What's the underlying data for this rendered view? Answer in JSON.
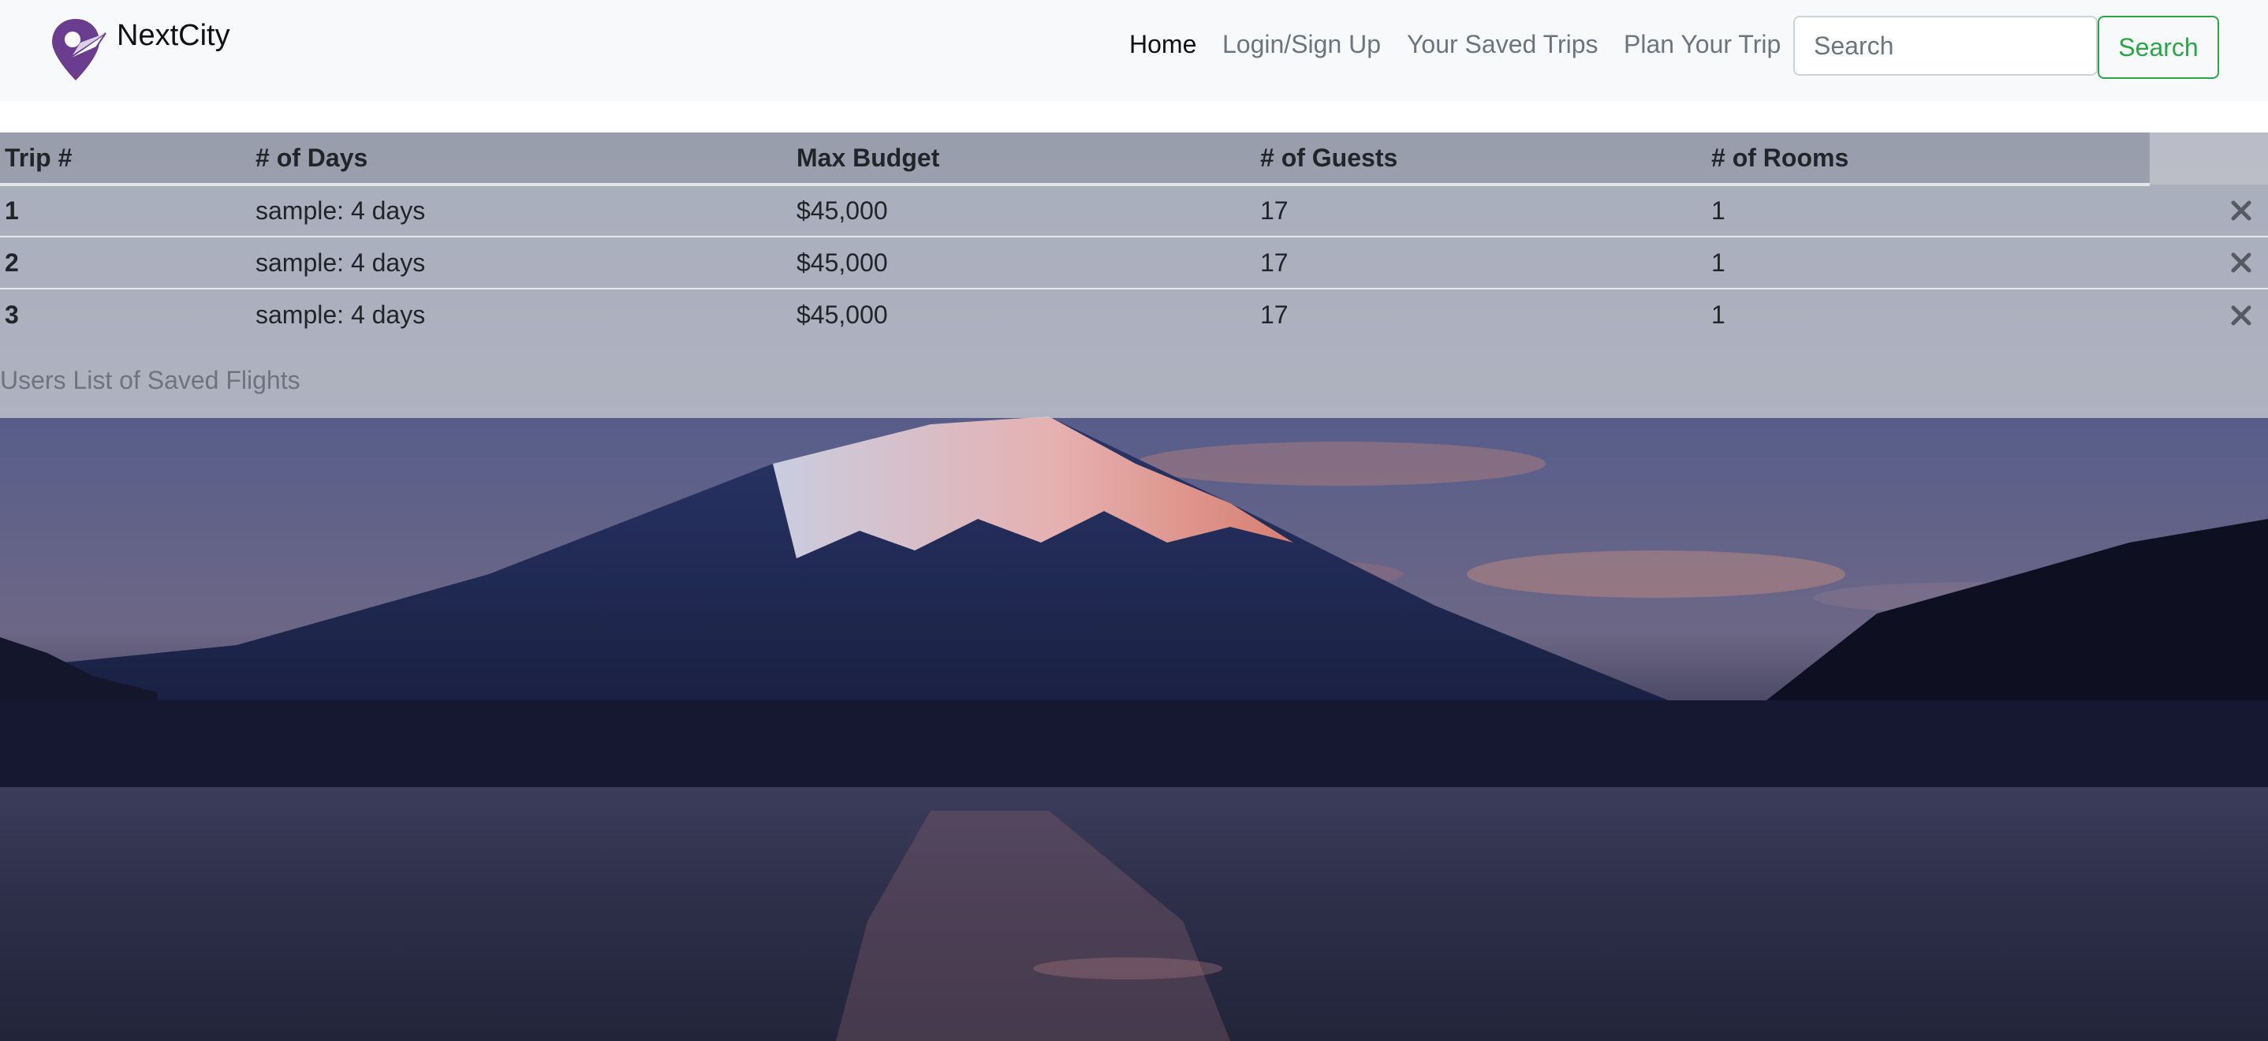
{
  "brand": {
    "name": "NextCity",
    "logo": "location-pin-plane-icon",
    "logo_color": "#6a3d8f"
  },
  "nav": {
    "links": [
      {
        "label": "Home",
        "active": true
      },
      {
        "label": "Login/Sign Up",
        "active": false
      },
      {
        "label": "Your Saved Trips",
        "active": false
      },
      {
        "label": "Plan Your Trip",
        "active": false
      }
    ],
    "search_placeholder": "Search",
    "search_button": "Search",
    "accent_color": "#28a745"
  },
  "table": {
    "headers": [
      "Trip #",
      "# of Days",
      "Max Budget",
      "# of Guests",
      "# of Rooms"
    ],
    "rows": [
      {
        "trip": "1",
        "days": "sample: 4 days",
        "budget": "$45,000",
        "guests": "17",
        "rooms": "1",
        "action_icon": "close-icon"
      },
      {
        "trip": "2",
        "days": "sample: 4 days",
        "budget": "$45,000",
        "guests": "17",
        "rooms": "1",
        "action_icon": "close-icon"
      },
      {
        "trip": "3",
        "days": "sample: 4 days",
        "budget": "$45,000",
        "guests": "17",
        "rooms": "1",
        "action_icon": "close-icon"
      }
    ],
    "caption": "Users List of Saved Flights"
  },
  "background": {
    "subject": "snow-capped-mountain-over-lake"
  }
}
